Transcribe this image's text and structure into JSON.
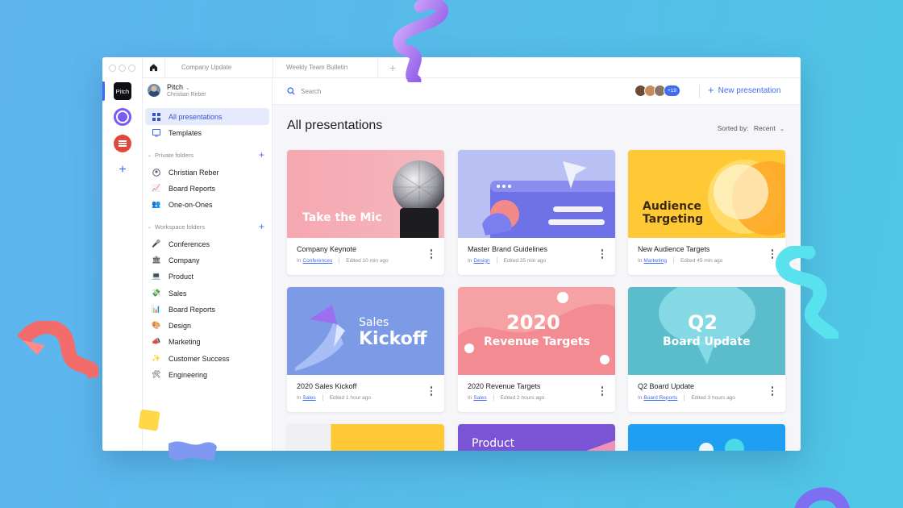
{
  "colors": {
    "accent": "#3f6bf3",
    "background": "#55bde9"
  },
  "tabs": {
    "home_icon": "home-icon",
    "items": [
      "Company Update",
      "Weekly Team Bulletin"
    ],
    "add": "+"
  },
  "rail": {
    "workspace_label": "Pitch",
    "add": "+"
  },
  "account": {
    "name": "Pitch",
    "user": "Christian Reber"
  },
  "sidebar": {
    "all_presentations": "All presentations",
    "templates": "Templates",
    "private_header": "Private folders",
    "private_items": [
      "Christian Reber",
      "Board Reports",
      "One-on-Ones"
    ],
    "workspace_header": "Workspace folders",
    "workspace_items": [
      "Conferences",
      "Company",
      "Product",
      "Sales",
      "Board Reports",
      "Design",
      "Marketing",
      "Customer Success",
      "Engineering"
    ],
    "add": "+"
  },
  "topbar": {
    "search_placeholder": "Search",
    "collaborators_more": "+19",
    "new_presentation": "New presentation"
  },
  "main": {
    "title": "All presentations",
    "sort_label": "Sorted by:",
    "sort_value": "Recent"
  },
  "cards": [
    {
      "title": "Company Keynote",
      "in": "In",
      "folder": "Conferences",
      "edited": "Edited 10 min ago",
      "thumb_text": "Take the Mic"
    },
    {
      "title": "Master Brand Guidelines",
      "in": "In",
      "folder": "Design",
      "edited": "Edited 25 min ago"
    },
    {
      "title": "New Audience Targets",
      "in": "In",
      "folder": "Marketing",
      "edited": "Edited 45 min ago",
      "thumb_text_1": "Audience",
      "thumb_text_2": "Targeting"
    },
    {
      "title": "2020 Sales Kickoff",
      "in": "In",
      "folder": "Sales",
      "edited": "Edited 1 hour ago",
      "thumb_text_1": "Sales",
      "thumb_text_2": "Kickoff"
    },
    {
      "title": "2020 Revenue Targets",
      "in": "In",
      "folder": "Sales",
      "edited": "Edited 2 hours ago",
      "thumb_text_1": "2020",
      "thumb_text_2": "Revenue Targets"
    },
    {
      "title": "Q2 Board Update",
      "in": "In",
      "folder": "Board Reports",
      "edited": "Edited 3 hours ago",
      "thumb_text_1": "Q2",
      "thumb_text_2": "Board Update"
    },
    {
      "thumb_text": "Product"
    }
  ]
}
